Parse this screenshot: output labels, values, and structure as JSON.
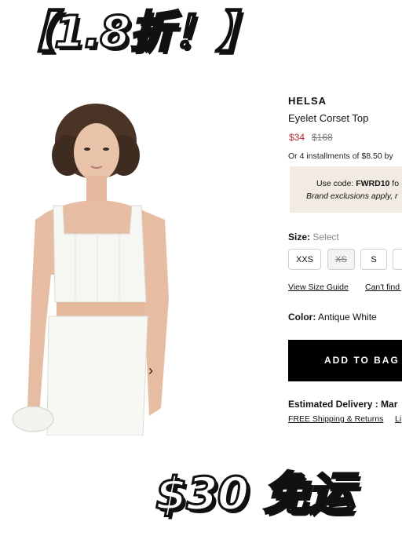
{
  "promo": {
    "top_text": "【1.8折！】",
    "bottom_text": "$30 免运"
  },
  "product": {
    "brand": "HELSA",
    "name": "Eyelet Corset Top",
    "price_sale": "$34",
    "price_original": "$168",
    "installments": "Or 4 installments of $8.50 by"
  },
  "promo_box": {
    "line1_prefix": "Use code: ",
    "code": "FWRD10",
    "line1_suffix": " fo",
    "line2": "Brand exclusions apply, r"
  },
  "size": {
    "label": "Size:",
    "selected": "Select",
    "options": [
      "XXS",
      "XS",
      "S",
      ""
    ]
  },
  "links": {
    "size_guide": "View Size Guide",
    "cant_find": "Can't find y"
  },
  "color": {
    "label": "Color:",
    "value": "Antique White"
  },
  "cta": {
    "add_to_bag": "ADD TO BAG"
  },
  "delivery": {
    "label": "Estimated Delivery : Mar",
    "shipping": "FREE Shipping & Returns",
    "link2": "Li"
  },
  "icons": {
    "next": "chevron-right-icon"
  }
}
